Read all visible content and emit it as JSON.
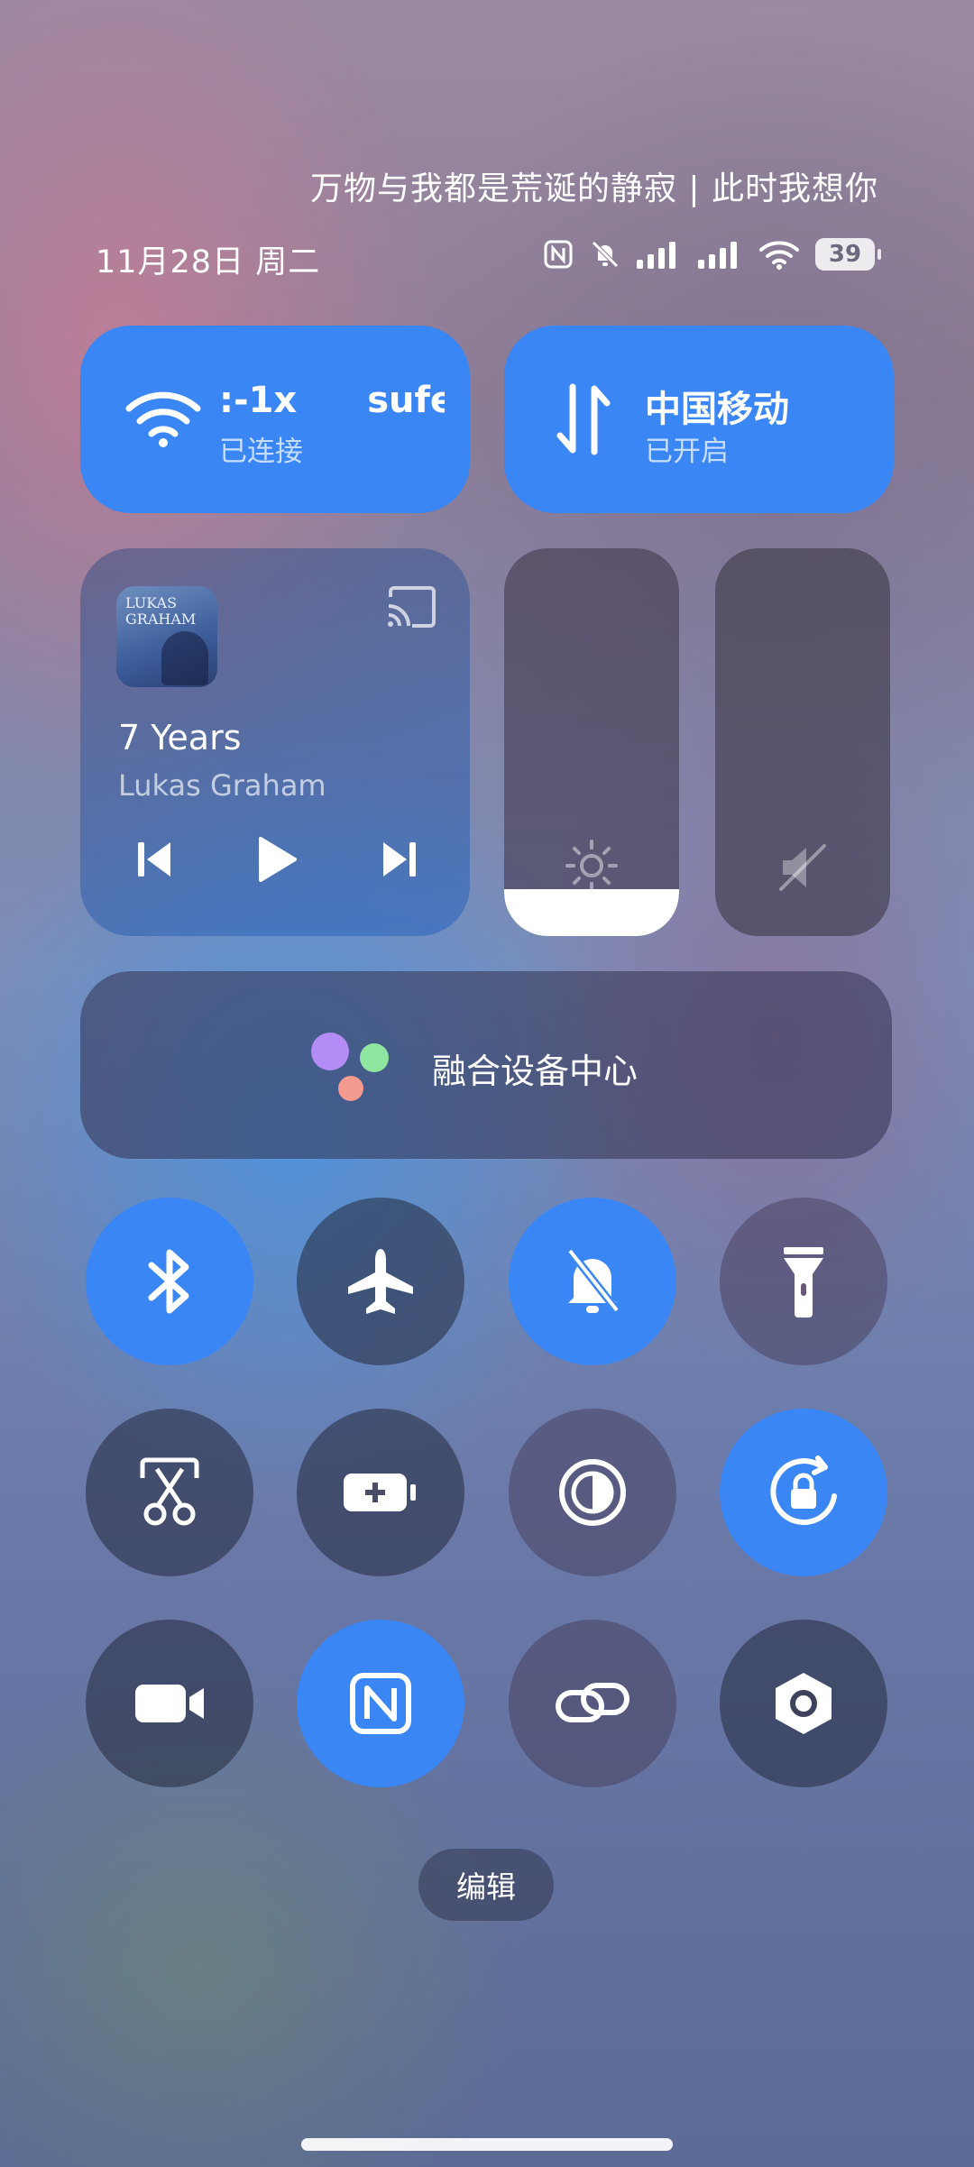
{
  "header": {
    "quote": "万物与我都是荒诞的静寂 | 此时我想你",
    "date": "11月28日 周二",
    "battery": "39"
  },
  "wifi_tile": {
    "ssid_left": ":-1x",
    "ssid_right": "sufe",
    "status": "已连接"
  },
  "mobile_tile": {
    "carrier": "中国移动",
    "status": "已开启"
  },
  "media": {
    "album_text_1": "LUKAS",
    "album_text_2": "GRAHAM",
    "title": "7 Years",
    "artist": "Lukas Graham"
  },
  "sliders": {
    "brightness_level": 0.12,
    "volume_level": 0.0
  },
  "device_center": {
    "label": "融合设备中心"
  },
  "toggles": [
    {
      "icon": "bluetooth-icon",
      "active": true
    },
    {
      "icon": "airplane-icon",
      "active": false
    },
    {
      "icon": "silent-bell-icon",
      "active": true
    },
    {
      "icon": "flashlight-icon",
      "active": false
    },
    {
      "icon": "screenshot-icon",
      "active": false
    },
    {
      "icon": "battery-saver-icon",
      "active": false
    },
    {
      "icon": "dark-mode-icon",
      "active": false
    },
    {
      "icon": "rotation-lock-icon",
      "active": true
    },
    {
      "icon": "screen-record-icon",
      "active": false
    },
    {
      "icon": "nfc-icon",
      "active": true
    },
    {
      "icon": "link-icon",
      "active": false
    },
    {
      "icon": "settings-hex-icon",
      "active": false
    }
  ],
  "edit_button": {
    "label": "编辑"
  },
  "colors": {
    "accent": "#3a86f5"
  }
}
